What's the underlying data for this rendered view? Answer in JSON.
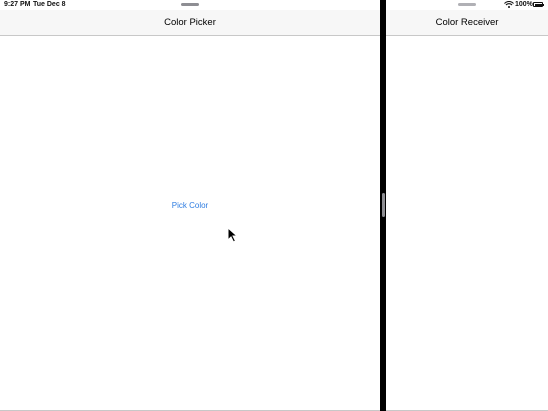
{
  "status_bar": {
    "time": "9:27 PM",
    "date": "Tue Dec 8",
    "battery_percent": "100%",
    "battery_level": 1.0
  },
  "left_pane": {
    "title": "Color Picker",
    "button_label": "Pick Color"
  },
  "right_pane": {
    "title": "Color Receiver"
  },
  "colors": {
    "accent": "#2f7de1",
    "divider": "#000000",
    "navbar_bg": "#f7f7f7"
  },
  "icons": [
    "wifi-icon",
    "battery-icon",
    "grabber-icon",
    "divider-handle-icon",
    "mouse-pointer-icon"
  ]
}
